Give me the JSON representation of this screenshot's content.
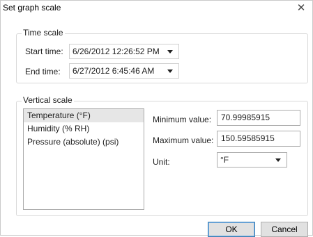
{
  "dialog": {
    "title": "Set graph scale",
    "close_glyph": "✕"
  },
  "time_scale": {
    "legend": "Time scale",
    "start_label": "Start time:",
    "start_value": "6/26/2012 12:26:52 PM",
    "end_label": "End time:",
    "end_value": "6/27/2012 6:45:46 AM"
  },
  "vertical_scale": {
    "legend": "Vertical scale",
    "items": [
      {
        "label": "Temperature (°F)",
        "selected": true
      },
      {
        "label": "Humidity (% RH)",
        "selected": false
      },
      {
        "label": "Pressure (absolute) (psi)",
        "selected": false
      }
    ],
    "min_label": "Minimum value:",
    "min_value": "70.99985915",
    "max_label": "Maximum value:",
    "max_value": "150.59585915",
    "unit_label": "Unit:",
    "unit_value": "°F"
  },
  "buttons": {
    "ok": "OK",
    "cancel": "Cancel"
  },
  "icons": {
    "dropdown": "chevron-down-icon",
    "close": "close-icon"
  }
}
